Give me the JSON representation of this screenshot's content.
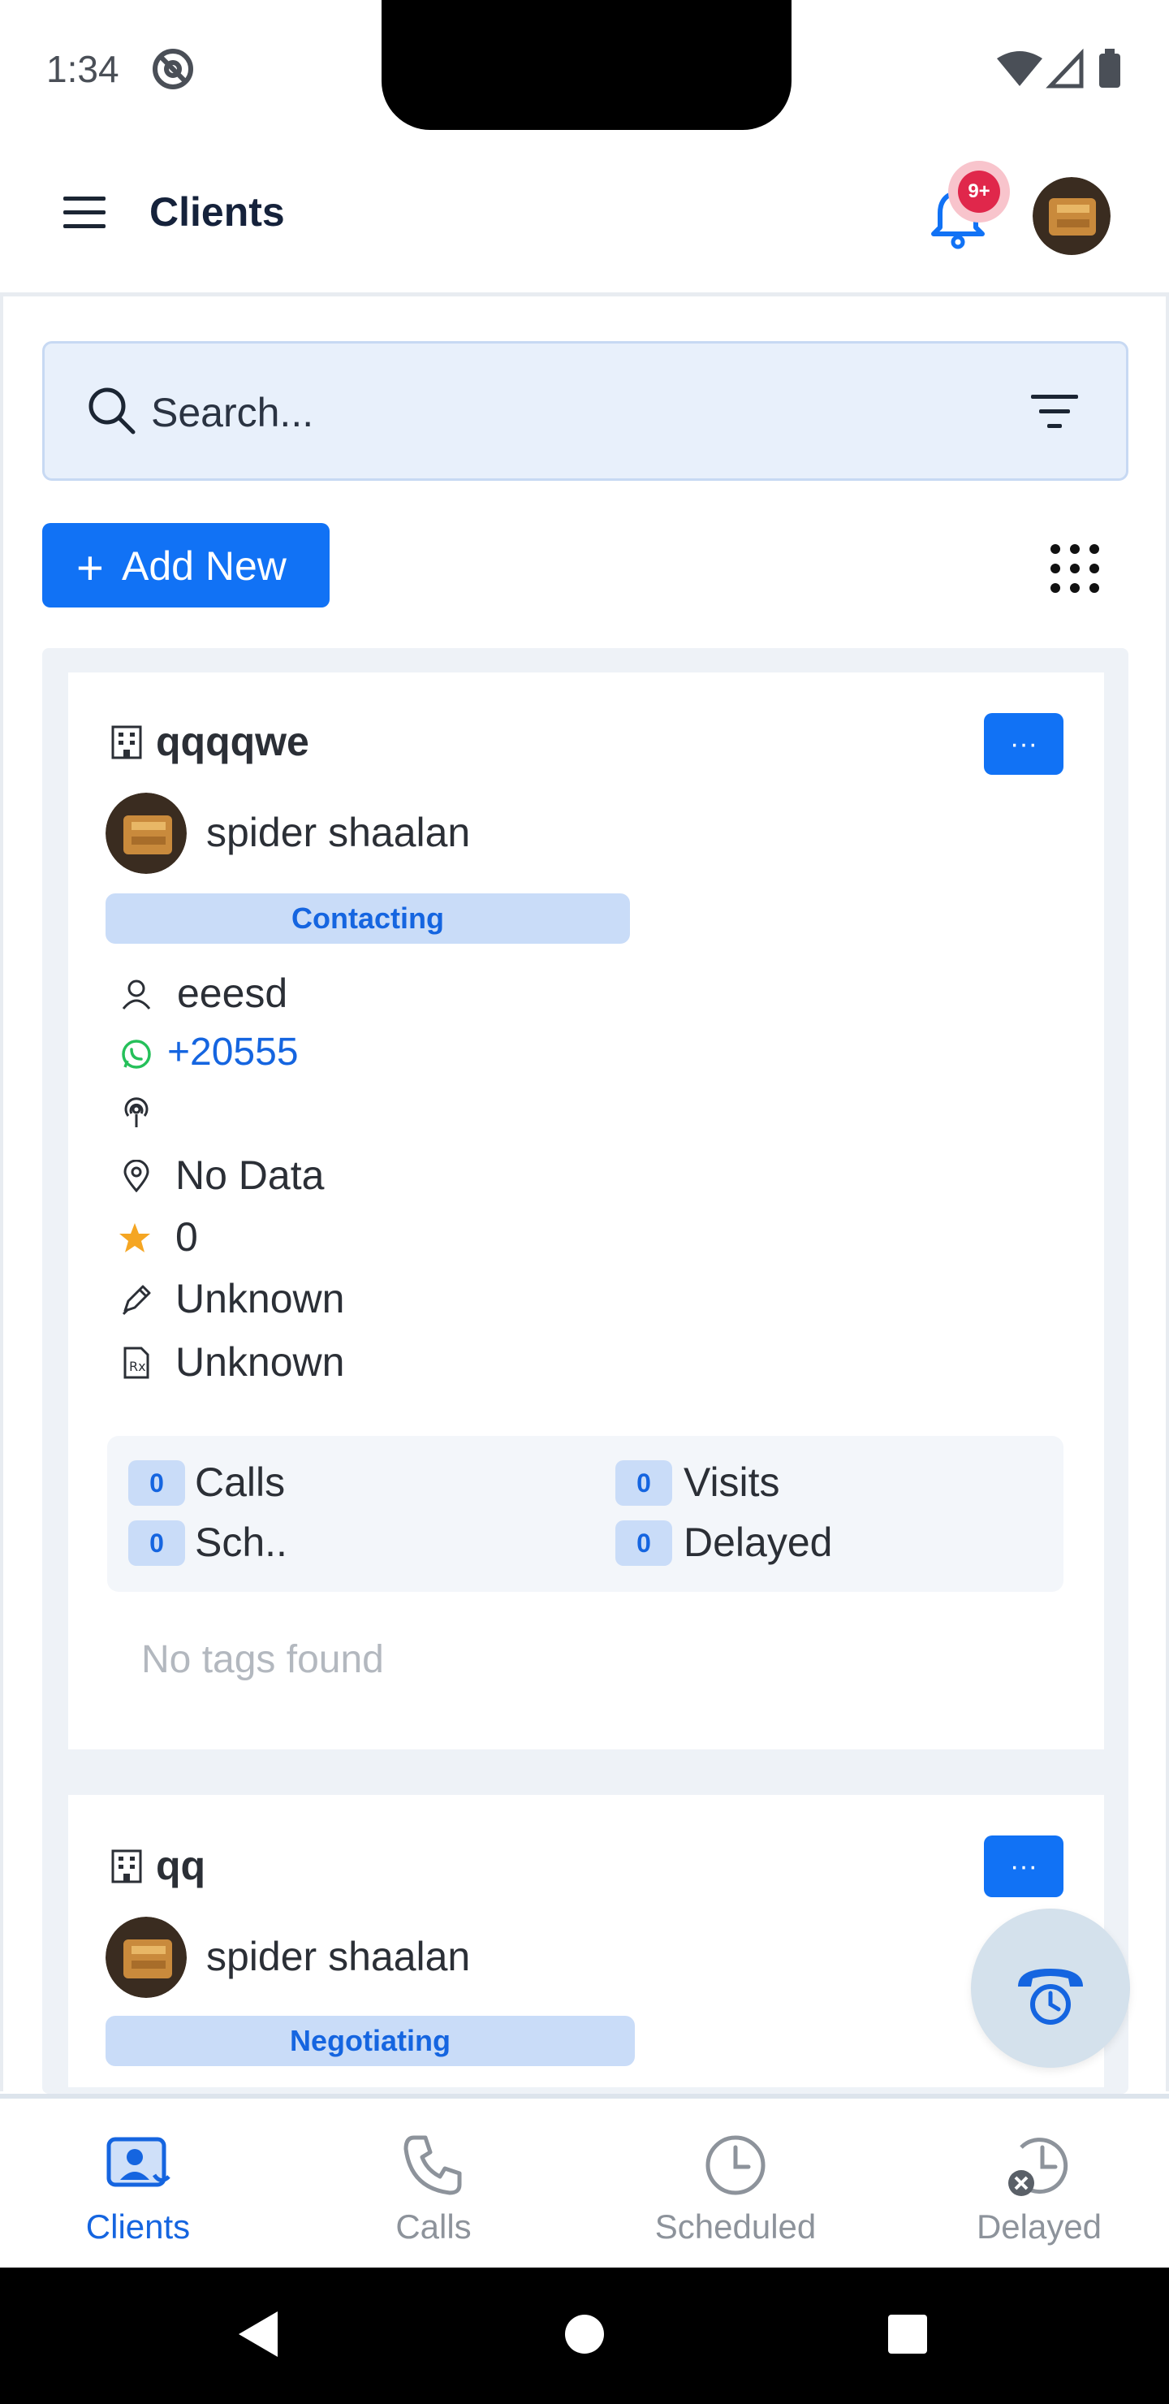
{
  "status_bar": {
    "time": "1:34"
  },
  "header": {
    "title": "Clients",
    "notification_badge": "9+"
  },
  "search": {
    "placeholder": "Search..."
  },
  "toolbar": {
    "add_new_plus": "+",
    "add_new_label": "Add New"
  },
  "cards": [
    {
      "title": "qqqqwe",
      "more_label": "···",
      "owner": "spider shaalan",
      "status": "Contacting",
      "contact_name": "eeesd",
      "phone": "+20555",
      "location": "No Data",
      "rating": "0",
      "field_1": "Unknown",
      "field_2": "Unknown",
      "stats": {
        "calls_count": "0",
        "calls_label": "Calls",
        "visits_count": "0",
        "visits_label": "Visits",
        "scheduled_count": "0",
        "scheduled_label": "Sch..",
        "delayed_count": "0",
        "delayed_label": "Delayed"
      },
      "tags_empty": "No tags found"
    },
    {
      "title": "qq",
      "more_label": "···",
      "owner": "spider shaalan",
      "status": "Negotiating"
    }
  ],
  "bottom_nav": [
    {
      "label": "Clients",
      "active": true
    },
    {
      "label": "Calls",
      "active": false
    },
    {
      "label": "Scheduled",
      "active": false
    },
    {
      "label": "Delayed",
      "active": false
    }
  ],
  "colors": {
    "accent": "#1172f5",
    "badge": "#e0274b",
    "whatsapp": "#25c05a",
    "star": "#f5a623"
  }
}
